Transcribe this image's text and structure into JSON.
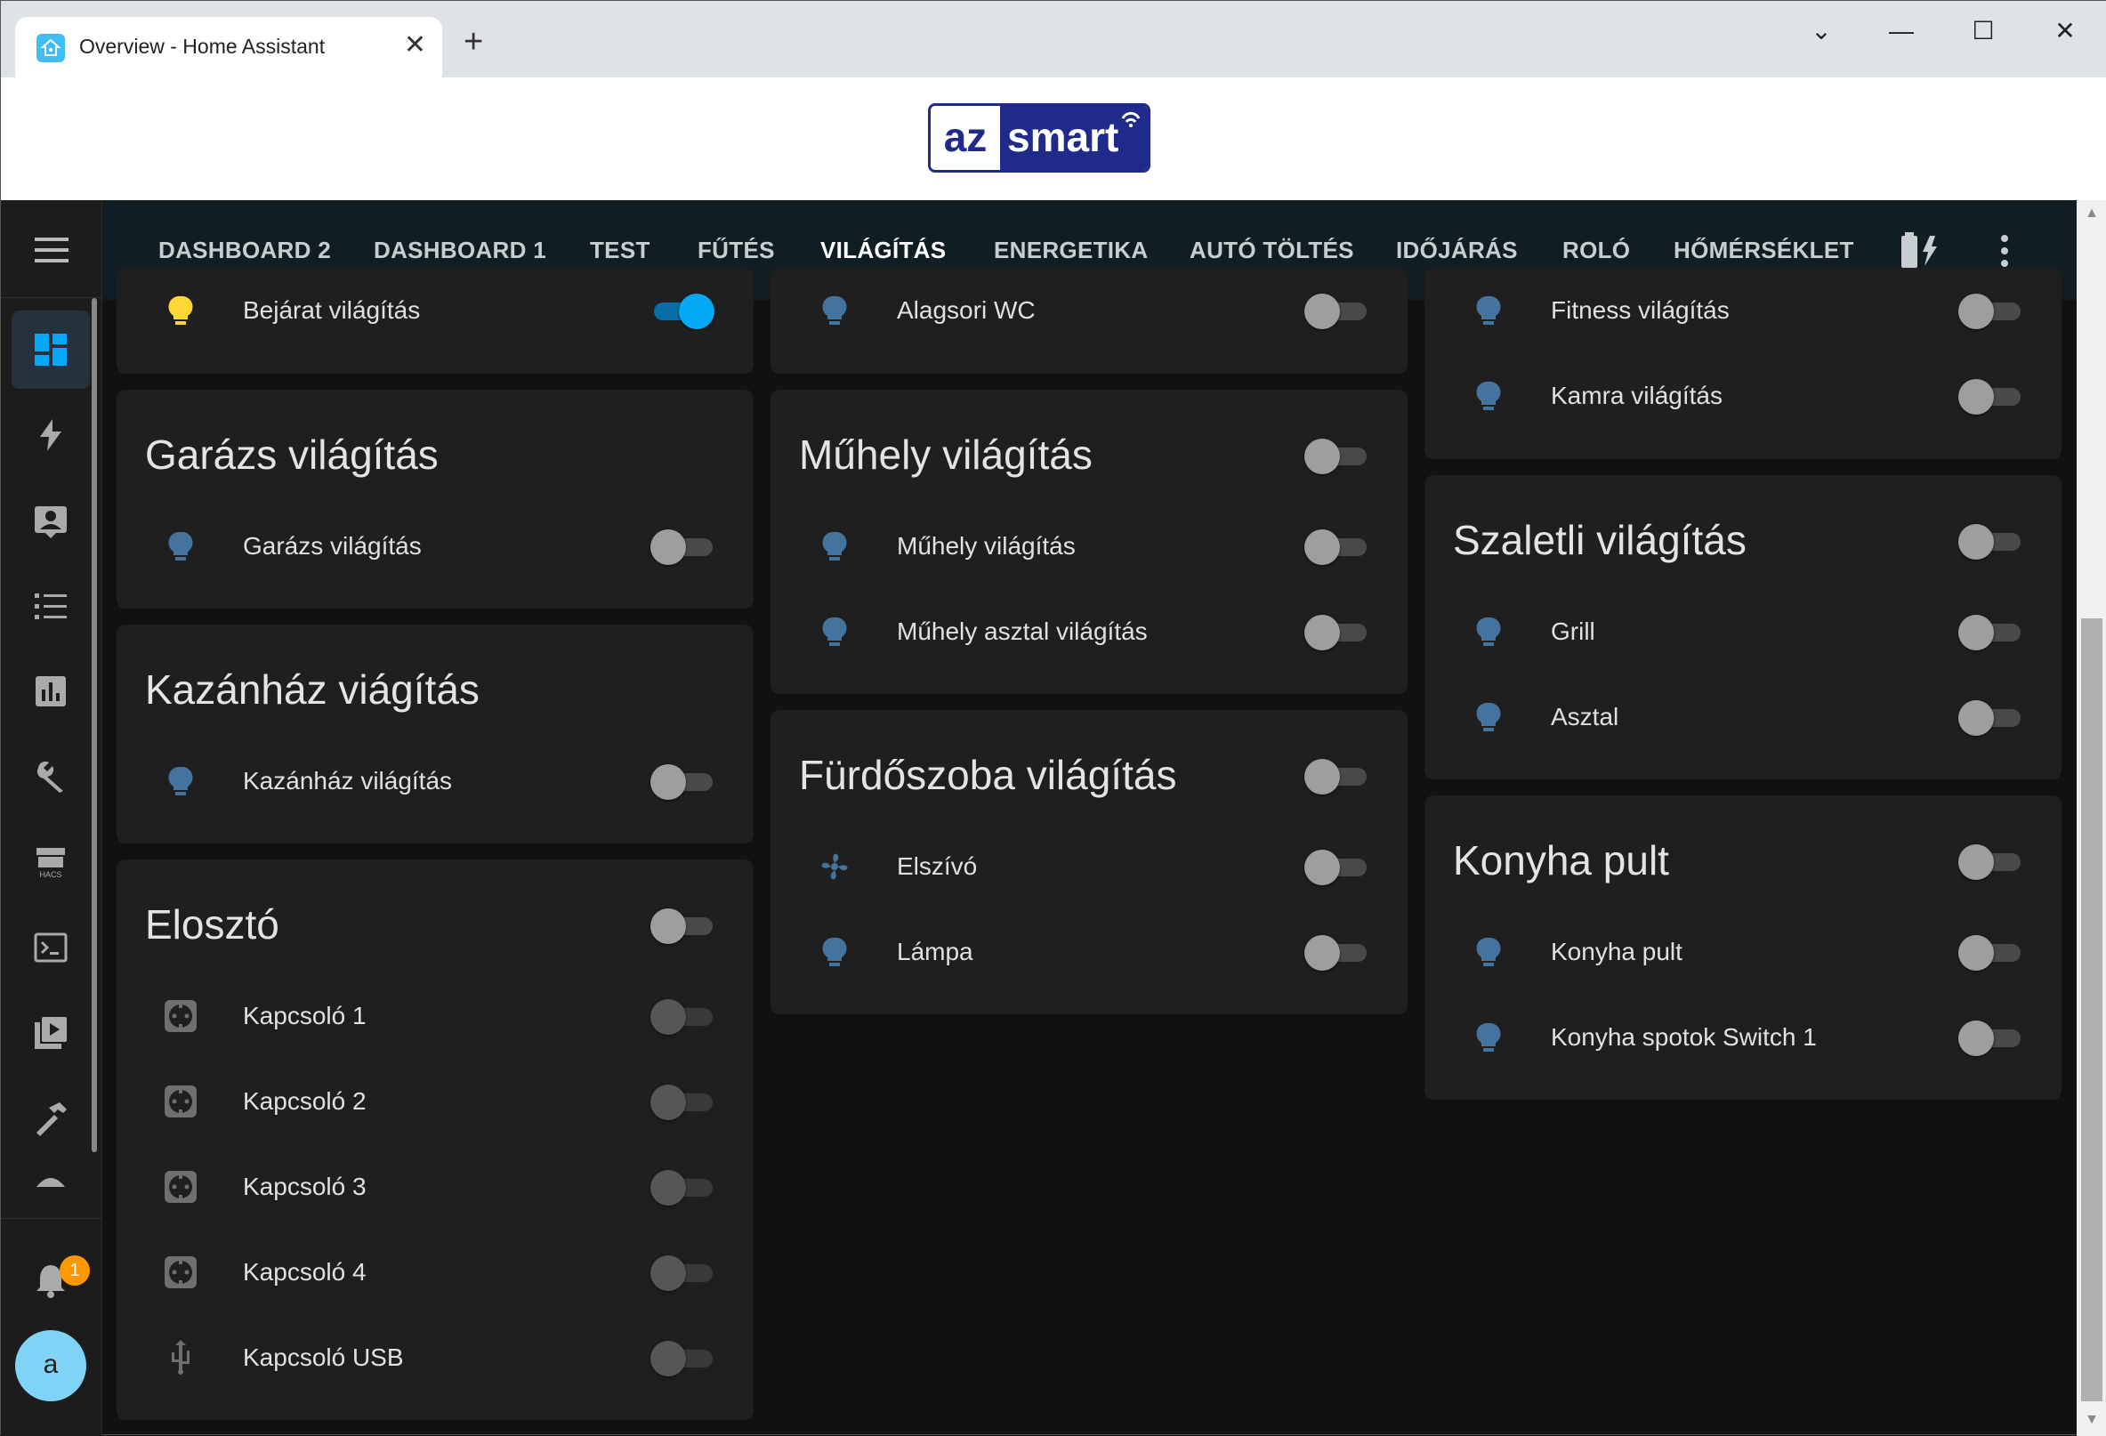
{
  "browser": {
    "tab_title": "Overview - Home Assistant",
    "tab_close": "✕",
    "new_tab": "+",
    "window_controls": [
      "⌄",
      "—",
      "☐",
      "✕"
    ]
  },
  "banner": {
    "logo_left": "az",
    "logo_right": "smart"
  },
  "sidebar": {
    "menu_icon": "hamburger-icon",
    "items": [
      "overview-icon",
      "energy-icon",
      "logbook-icon",
      "history-icon",
      "statistics-icon",
      "config-icon",
      "hacs-icon",
      "terminal-icon",
      "media-icon",
      "developer-tools-icon",
      "fan-icon"
    ],
    "notification_count": "1",
    "user_initial": "a"
  },
  "nav": {
    "tabs": [
      "DASHBOARD 2",
      "DASHBOARD 1",
      "TEST",
      "FŰTÉS",
      "VILÁGÍTÁS",
      "ENERGETIKA",
      "AUTÓ TÖLTÉS",
      "IDŐJÁRÁS",
      "ROLÓ",
      "HŐMÉRSÉKLET"
    ],
    "active": "VILÁGÍTÁS"
  },
  "colors": {
    "accent": "#03a9f4",
    "bulb_on": "#fdd835",
    "bulb_off": "#44739e",
    "card": "#1f1f1f",
    "header": "#101e24"
  },
  "cards": {
    "col1": {
      "bejarat": {
        "row_label": "Bejárat világítás",
        "state": "on"
      },
      "garazs": {
        "title": "Garázs világítás",
        "rows": [
          {
            "label": "Garázs világítás",
            "state": "off"
          }
        ]
      },
      "kazanhaz": {
        "title": "Kazánház viágítás",
        "rows": [
          {
            "label": "Kazánház világítás",
            "state": "off"
          }
        ]
      },
      "eloszto": {
        "title": "Elosztó",
        "state": "off",
        "rows": [
          {
            "label": "Kapcsoló 1",
            "state": "unavailable"
          },
          {
            "label": "Kapcsoló 2",
            "state": "unavailable"
          },
          {
            "label": "Kapcsoló 3",
            "state": "unavailable"
          },
          {
            "label": "Kapcsoló 4",
            "state": "unavailable"
          },
          {
            "label": "Kapcsoló USB",
            "state": "unavailable"
          }
        ]
      }
    },
    "col2": {
      "alagsori": {
        "row_label": "Alagsori WC",
        "state": "off"
      },
      "muhely": {
        "title": "Műhely világítás",
        "state": "off",
        "rows": [
          {
            "label": "Műhely világítás",
            "state": "off"
          },
          {
            "label": "Műhely asztal világítás",
            "state": "off"
          }
        ]
      },
      "furdo": {
        "title": "Fürdőszoba világítás",
        "state": "off",
        "rows": [
          {
            "label": "Elszívó",
            "state": "off"
          },
          {
            "label": "Lámpa",
            "state": "off"
          }
        ]
      }
    },
    "col3": {
      "fitness": {
        "rows": [
          {
            "label": "Fitness világítás",
            "state": "off"
          },
          {
            "label": "Kamra világítás",
            "state": "off"
          }
        ]
      },
      "szaletli": {
        "title": "Szaletli világítás",
        "state": "off",
        "rows": [
          {
            "label": "Grill",
            "state": "off"
          },
          {
            "label": "Asztal",
            "state": "off"
          }
        ]
      },
      "konyha": {
        "title": "Konyha pult",
        "state": "off",
        "rows": [
          {
            "label": "Konyha pult",
            "state": "off"
          },
          {
            "label": "Konyha spotok Switch 1",
            "state": "off"
          }
        ]
      }
    }
  }
}
